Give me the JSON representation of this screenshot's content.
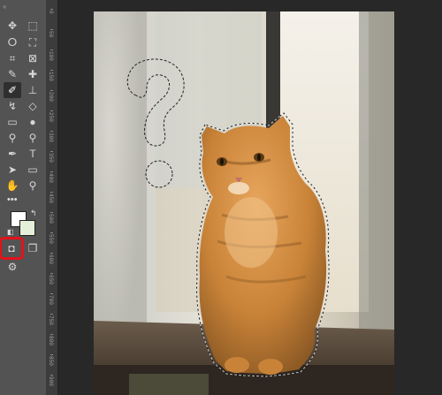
{
  "ruler": {
    "labels": [
      "0",
      "50",
      "100",
      "150",
      "200",
      "250",
      "300",
      "350",
      "400",
      "450",
      "500",
      "550",
      "600",
      "650",
      "700",
      "750",
      "800",
      "850",
      "900"
    ]
  },
  "colors": {
    "toolbar_bg": "#535353",
    "canvas_bg": "#282828",
    "highlight": "#e3121b",
    "foreground_color": "#ffffff",
    "background_color": "#e4f0da"
  },
  "tools": [
    {
      "name": "move-tool-icon",
      "glyph": "✥"
    },
    {
      "name": "marquee-tool-icon",
      "glyph": "⬚"
    },
    {
      "name": "lasso-tool-icon",
      "glyph": "ⵔ"
    },
    {
      "name": "object-selection-tool-icon",
      "glyph": "⛶"
    },
    {
      "name": "crop-tool-icon",
      "glyph": "⌗"
    },
    {
      "name": "frame-tool-icon",
      "glyph": "⊠"
    },
    {
      "name": "eyedropper-tool-icon",
      "glyph": "✎"
    },
    {
      "name": "healing-brush-tool-icon",
      "glyph": "✚"
    },
    {
      "name": "brush-tool-icon",
      "glyph": "✐"
    },
    {
      "name": "clone-stamp-tool-icon",
      "glyph": "⊥"
    },
    {
      "name": "history-brush-tool-icon",
      "glyph": "↯"
    },
    {
      "name": "eraser-tool-icon",
      "glyph": "◇"
    },
    {
      "name": "gradient-tool-icon",
      "glyph": "▭"
    },
    {
      "name": "blur-tool-icon",
      "glyph": "●"
    },
    {
      "name": "dodge-tool-icon",
      "glyph": "⚲"
    },
    {
      "name": "pen-tool-icon",
      "glyph": "⚲"
    },
    {
      "name": "type-tool-icon",
      "glyph": "T"
    },
    {
      "name": "path-selection-tool-icon",
      "glyph": "➤"
    },
    {
      "name": "shape-tool-icon",
      "glyph": "▭"
    },
    {
      "name": "hand-tool-icon",
      "glyph": "✋"
    },
    {
      "name": "zoom-tool-icon",
      "glyph": "⚲"
    },
    {
      "name": "quick-mask-mode-icon",
      "glyph": "◘"
    },
    {
      "name": "screen-mode-icon",
      "glyph": "❐"
    },
    {
      "name": "extra-tool-icon",
      "glyph": "⚙"
    }
  ]
}
